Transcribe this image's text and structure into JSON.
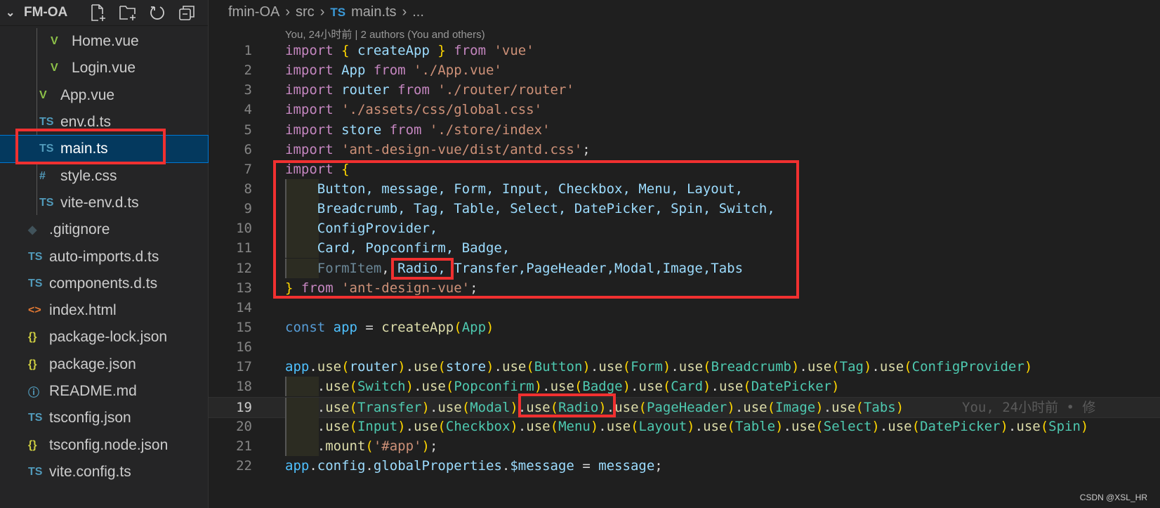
{
  "explorer": {
    "title": "FM-OA",
    "actions": [
      "new-file-icon",
      "new-folder-icon",
      "refresh-icon",
      "collapse-all-icon"
    ],
    "items": [
      {
        "label": "Home.vue",
        "icon": "vue",
        "depth": 2
      },
      {
        "label": "Login.vue",
        "icon": "vue",
        "depth": 2
      },
      {
        "label": "App.vue",
        "icon": "vue",
        "depth": 1
      },
      {
        "label": "env.d.ts",
        "icon": "ts",
        "depth": 1
      },
      {
        "label": "main.ts",
        "icon": "ts",
        "depth": 1,
        "selected": true
      },
      {
        "label": "style.css",
        "icon": "css",
        "depth": 1
      },
      {
        "label": "vite-env.d.ts",
        "icon": "ts",
        "depth": 1
      },
      {
        "label": ".gitignore",
        "icon": "git",
        "depth": 0
      },
      {
        "label": "auto-imports.d.ts",
        "icon": "ts",
        "depth": 0
      },
      {
        "label": "components.d.ts",
        "icon": "ts",
        "depth": 0
      },
      {
        "label": "index.html",
        "icon": "html",
        "depth": 0
      },
      {
        "label": "package-lock.json",
        "icon": "json",
        "depth": 0
      },
      {
        "label": "package.json",
        "icon": "json",
        "depth": 0
      },
      {
        "label": "README.md",
        "icon": "info",
        "depth": 0
      },
      {
        "label": "tsconfig.json",
        "icon": "tsconfig",
        "depth": 0
      },
      {
        "label": "tsconfig.node.json",
        "icon": "json",
        "depth": 0
      },
      {
        "label": "vite.config.ts",
        "icon": "ts",
        "depth": 0
      }
    ],
    "icon_glyphs": {
      "vue": "V",
      "ts": "TS",
      "css": "#",
      "git": "◆",
      "html": "<>",
      "json": "{}",
      "info": "ⓘ",
      "tsconfig": "TS"
    },
    "icon_colors": {
      "vue": "#8dc149",
      "ts": "#519aba",
      "css": "#519aba",
      "git": "#41535b",
      "html": "#e37933",
      "json": "#cbcb41",
      "info": "#519aba",
      "tsconfig": "#519aba"
    }
  },
  "breadcrumb": {
    "items": [
      "fmin-OA",
      "src",
      "main.ts",
      "..."
    ],
    "file_icon": "TS"
  },
  "codelens": "You, 24小时前 | 2 authors (You and others)",
  "blame": {
    "line": 19,
    "text": "You, 24小时前 • 修"
  },
  "code": [
    [
      [
        "import ",
        "kw"
      ],
      [
        "{",
        "b1"
      ],
      [
        " createApp ",
        "var"
      ],
      [
        "}",
        "b1"
      ],
      [
        " from ",
        "kw"
      ],
      [
        "'vue'",
        "str"
      ]
    ],
    [
      [
        "import ",
        "kw"
      ],
      [
        "App ",
        "var"
      ],
      [
        "from ",
        "kw"
      ],
      [
        "'./App.vue'",
        "str"
      ]
    ],
    [
      [
        "import ",
        "kw"
      ],
      [
        "router ",
        "var"
      ],
      [
        "from ",
        "kw"
      ],
      [
        "'./router/router'",
        "str"
      ]
    ],
    [
      [
        "import ",
        "kw"
      ],
      [
        "'./assets/css/global.css'",
        "str"
      ]
    ],
    [
      [
        "import ",
        "kw"
      ],
      [
        "store ",
        "var"
      ],
      [
        "from ",
        "kw"
      ],
      [
        "'./store/index'",
        "str"
      ]
    ],
    [
      [
        "import ",
        "kw"
      ],
      [
        "'ant-design-vue/dist/antd.css'",
        "str"
      ],
      [
        ";",
        "p"
      ]
    ],
    [
      [
        "import ",
        "kw"
      ],
      [
        "{",
        "b1"
      ]
    ],
    [
      [
        "    ",
        "p"
      ],
      [
        "Button, message, Form, Input, Checkbox, Menu, Layout,",
        "var"
      ]
    ],
    [
      [
        "    ",
        "p"
      ],
      [
        "Breadcrumb, Tag, Table, Select, DatePicker, Spin, Switch,",
        "var"
      ]
    ],
    [
      [
        "    ",
        "p"
      ],
      [
        "ConfigProvider,",
        "var"
      ]
    ],
    [
      [
        "    ",
        "p"
      ],
      [
        "Card, Popconfirm, Badge,",
        "var"
      ]
    ],
    [
      [
        "    ",
        "p"
      ],
      [
        "FormItem",
        "dim"
      ],
      [
        ", ",
        "p"
      ],
      [
        "Radio, Transfer,PageHeader,Modal,Image,Tabs",
        "var"
      ]
    ],
    [
      [
        "}",
        "b1"
      ],
      [
        " from ",
        "kw"
      ],
      [
        "'ant-design-vue'",
        "str"
      ],
      [
        ";",
        "p"
      ]
    ],
    [],
    [
      [
        "const ",
        "st"
      ],
      [
        "app ",
        "const"
      ],
      [
        "= ",
        "p"
      ],
      [
        "createApp",
        "fn"
      ],
      [
        "(",
        "b1"
      ],
      [
        "App",
        "cls"
      ],
      [
        ")",
        "b1"
      ]
    ],
    [],
    [
      [
        "app",
        "const"
      ],
      [
        ".",
        "p"
      ],
      [
        "use",
        "fn"
      ],
      [
        "(",
        "b1"
      ],
      [
        "router",
        "var"
      ],
      [
        ")",
        "b1"
      ],
      [
        ".",
        "p"
      ],
      [
        "use",
        "fn"
      ],
      [
        "(",
        "b1"
      ],
      [
        "store",
        "var"
      ],
      [
        ")",
        "b1"
      ],
      [
        ".",
        "p"
      ],
      [
        "use",
        "fn"
      ],
      [
        "(",
        "b1"
      ],
      [
        "Button",
        "cls"
      ],
      [
        ")",
        "b1"
      ],
      [
        ".",
        "p"
      ],
      [
        "use",
        "fn"
      ],
      [
        "(",
        "b1"
      ],
      [
        "Form",
        "cls"
      ],
      [
        ")",
        "b1"
      ],
      [
        ".",
        "p"
      ],
      [
        "use",
        "fn"
      ],
      [
        "(",
        "b1"
      ],
      [
        "Breadcrumb",
        "cls"
      ],
      [
        ")",
        "b1"
      ],
      [
        ".",
        "p"
      ],
      [
        "use",
        "fn"
      ],
      [
        "(",
        "b1"
      ],
      [
        "Tag",
        "cls"
      ],
      [
        ")",
        "b1"
      ],
      [
        ".",
        "p"
      ],
      [
        "use",
        "fn"
      ],
      [
        "(",
        "b1"
      ],
      [
        "ConfigProvider",
        "cls"
      ],
      [
        ")",
        "b1"
      ]
    ],
    [
      [
        "    .",
        "p"
      ],
      [
        "use",
        "fn"
      ],
      [
        "(",
        "b1"
      ],
      [
        "Switch",
        "cls"
      ],
      [
        ")",
        "b1"
      ],
      [
        ".",
        "p"
      ],
      [
        "use",
        "fn"
      ],
      [
        "(",
        "b1"
      ],
      [
        "Popconfirm",
        "cls"
      ],
      [
        ")",
        "b1"
      ],
      [
        ".",
        "p"
      ],
      [
        "use",
        "fn"
      ],
      [
        "(",
        "b1"
      ],
      [
        "Badge",
        "cls"
      ],
      [
        ")",
        "b1"
      ],
      [
        ".",
        "p"
      ],
      [
        "use",
        "fn"
      ],
      [
        "(",
        "b1"
      ],
      [
        "Card",
        "cls"
      ],
      [
        ")",
        "b1"
      ],
      [
        ".",
        "p"
      ],
      [
        "use",
        "fn"
      ],
      [
        "(",
        "b1"
      ],
      [
        "DatePicker",
        "cls"
      ],
      [
        ")",
        "b1"
      ]
    ],
    [
      [
        "    .",
        "p"
      ],
      [
        "use",
        "fn"
      ],
      [
        "(",
        "b1"
      ],
      [
        "Transfer",
        "cls"
      ],
      [
        ")",
        "b1"
      ],
      [
        ".",
        "p"
      ],
      [
        "use",
        "fn"
      ],
      [
        "(",
        "b1"
      ],
      [
        "Modal",
        "cls"
      ],
      [
        ")",
        "b1"
      ],
      [
        ".",
        "p"
      ],
      [
        "use",
        "fn"
      ],
      [
        "(",
        "b1"
      ],
      [
        "Radio",
        "cls"
      ],
      [
        ")",
        "b1"
      ],
      [
        ".",
        "p"
      ],
      [
        "use",
        "fn"
      ],
      [
        "(",
        "b1"
      ],
      [
        "PageHeader",
        "cls"
      ],
      [
        ")",
        "b1"
      ],
      [
        ".",
        "p"
      ],
      [
        "use",
        "fn"
      ],
      [
        "(",
        "b1"
      ],
      [
        "Image",
        "cls"
      ],
      [
        ")",
        "b1"
      ],
      [
        ".",
        "p"
      ],
      [
        "use",
        "fn"
      ],
      [
        "(",
        "b1"
      ],
      [
        "Tabs",
        "cls"
      ],
      [
        ")",
        "b1"
      ]
    ],
    [
      [
        "    .",
        "p"
      ],
      [
        "use",
        "fn"
      ],
      [
        "(",
        "b1"
      ],
      [
        "Input",
        "cls"
      ],
      [
        ")",
        "b1"
      ],
      [
        ".",
        "p"
      ],
      [
        "use",
        "fn"
      ],
      [
        "(",
        "b1"
      ],
      [
        "Checkbox",
        "cls"
      ],
      [
        ")",
        "b1"
      ],
      [
        ".",
        "p"
      ],
      [
        "use",
        "fn"
      ],
      [
        "(",
        "b1"
      ],
      [
        "Menu",
        "cls"
      ],
      [
        ")",
        "b1"
      ],
      [
        ".",
        "p"
      ],
      [
        "use",
        "fn"
      ],
      [
        "(",
        "b1"
      ],
      [
        "Layout",
        "cls"
      ],
      [
        ")",
        "b1"
      ],
      [
        ".",
        "p"
      ],
      [
        "use",
        "fn"
      ],
      [
        "(",
        "b1"
      ],
      [
        "Table",
        "cls"
      ],
      [
        ")",
        "b1"
      ],
      [
        ".",
        "p"
      ],
      [
        "use",
        "fn"
      ],
      [
        "(",
        "b1"
      ],
      [
        "Select",
        "cls"
      ],
      [
        ")",
        "b1"
      ],
      [
        ".",
        "p"
      ],
      [
        "use",
        "fn"
      ],
      [
        "(",
        "b1"
      ],
      [
        "DatePicker",
        "cls"
      ],
      [
        ")",
        "b1"
      ],
      [
        ".",
        "p"
      ],
      [
        "use",
        "fn"
      ],
      [
        "(",
        "b1"
      ],
      [
        "Spin",
        "cls"
      ],
      [
        ")",
        "b1"
      ]
    ],
    [
      [
        "    .",
        "p"
      ],
      [
        "mount",
        "fn"
      ],
      [
        "(",
        "b1"
      ],
      [
        "'#app'",
        "str"
      ],
      [
        ")",
        "b1"
      ],
      [
        ";",
        "p"
      ]
    ],
    [
      [
        "app",
        "const"
      ],
      [
        ".",
        "p"
      ],
      [
        "config",
        "var"
      ],
      [
        ".",
        "p"
      ],
      [
        "globalProperties",
        "var"
      ],
      [
        ".",
        "p"
      ],
      [
        "$message",
        "var"
      ],
      [
        " = ",
        "p"
      ],
      [
        "message",
        "var"
      ],
      [
        ";",
        "p"
      ]
    ]
  ],
  "watermark": "CSDN @XSL_HR"
}
